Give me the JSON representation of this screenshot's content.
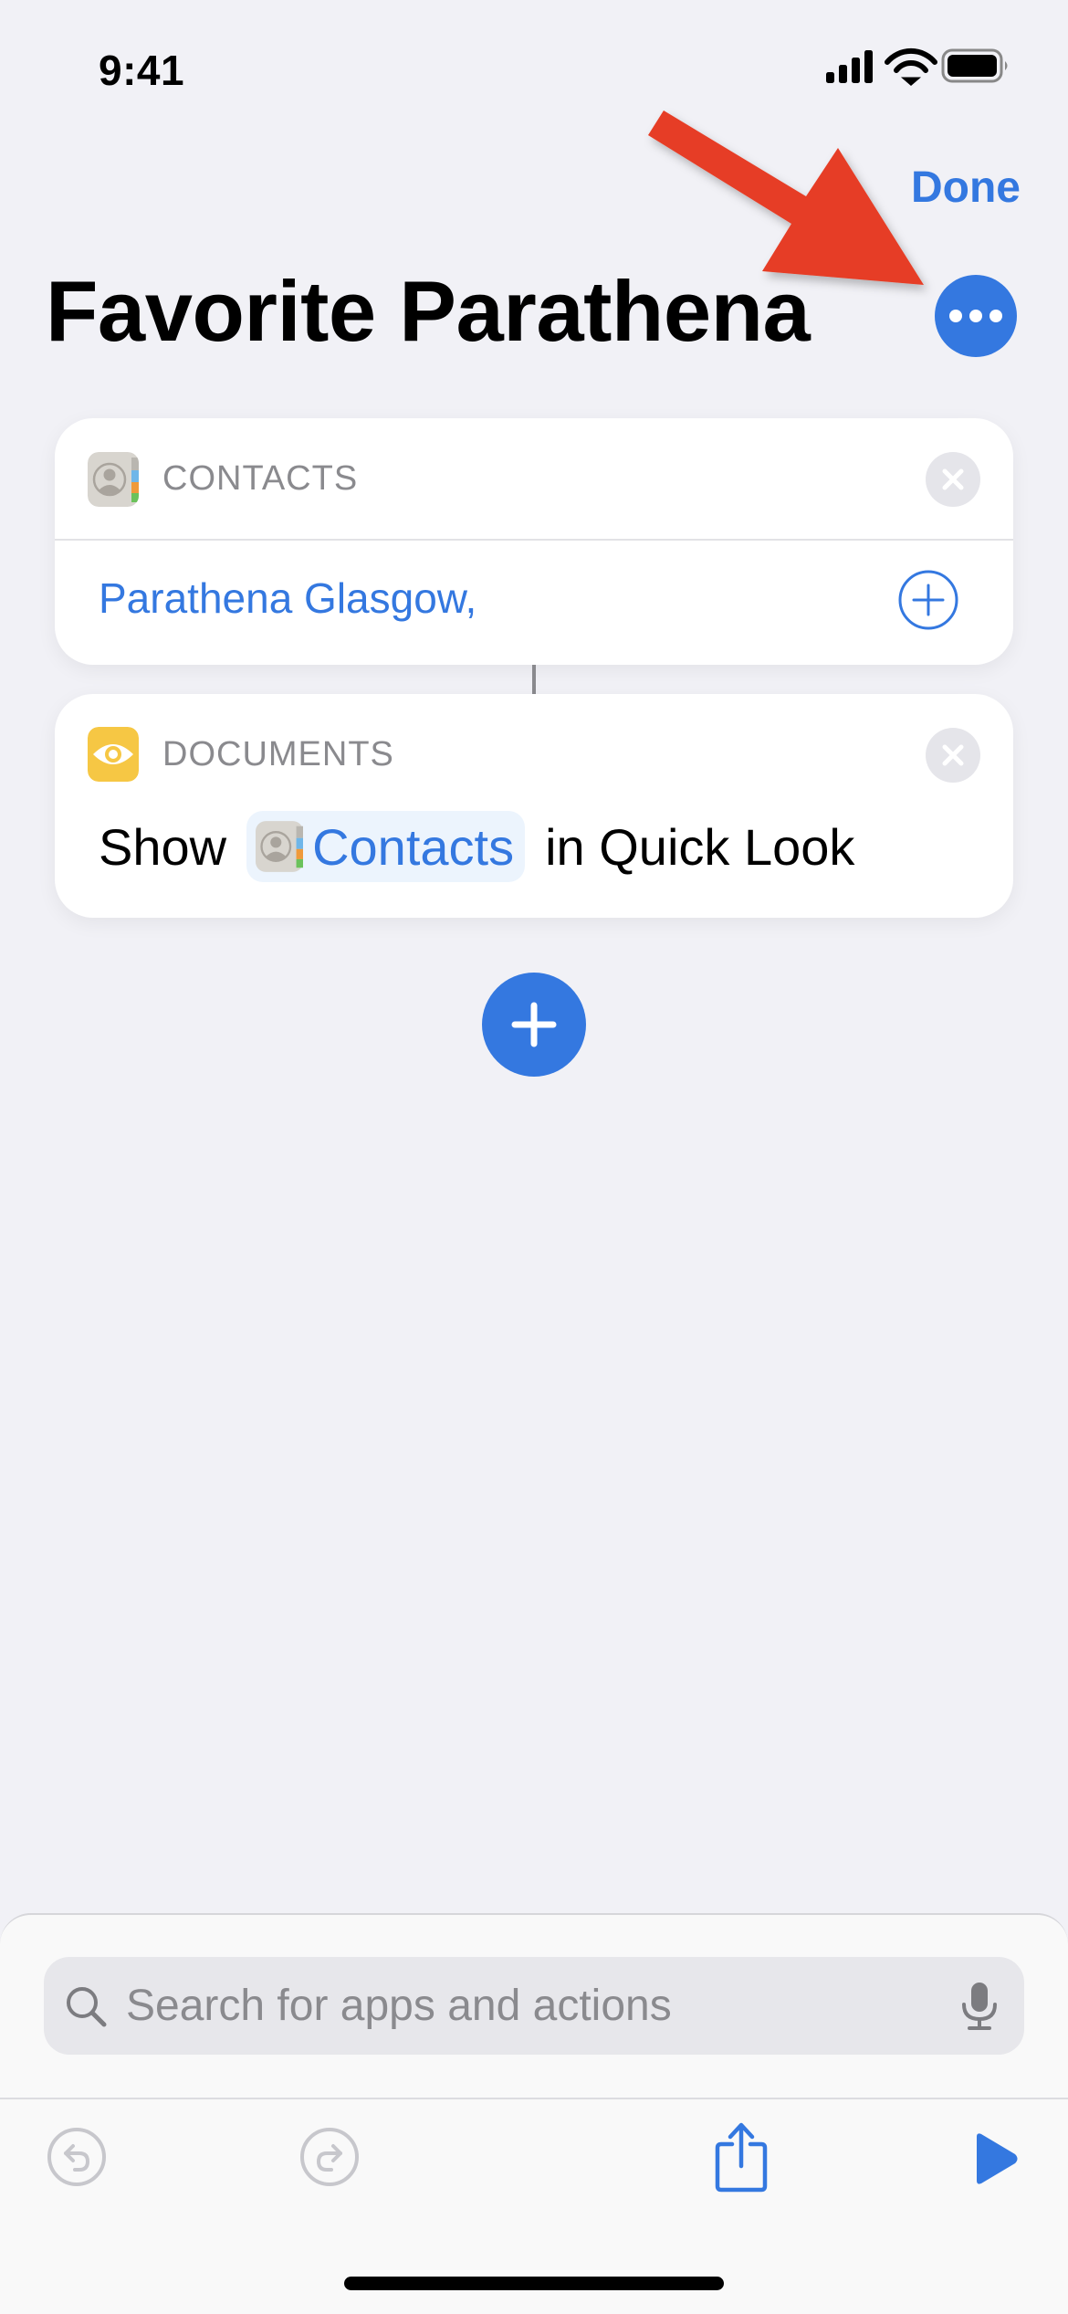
{
  "status_bar": {
    "time": "9:41",
    "icons": [
      "cellular-signal-icon",
      "wifi-icon",
      "battery-icon"
    ]
  },
  "nav": {
    "done_label": "Done",
    "title": "Favorite Parathena",
    "more_icon": "ellipsis-circle-icon"
  },
  "annotation": {
    "type": "arrow",
    "color": "#e63e25",
    "points_to": "more-options-button"
  },
  "actions": [
    {
      "category": "CONTACTS",
      "icon": "contacts-app-icon",
      "value": "Parathena Glasgow,",
      "add_icon": "plus-circle-icon"
    },
    {
      "category": "DOCUMENTS",
      "icon": "quick-look-eye-icon",
      "text_before": "Show",
      "variable": {
        "label": "Contacts",
        "icon": "contacts-app-icon"
      },
      "text_after": "in Quick Look"
    }
  ],
  "add_action_icon": "plus-icon",
  "search": {
    "placeholder": "Search for apps and actions",
    "search_icon": "magnifying-glass-icon",
    "mic_icon": "microphone-icon"
  },
  "toolbar": {
    "items": [
      {
        "name": "undo",
        "icon": "undo-icon",
        "enabled": false
      },
      {
        "name": "redo",
        "icon": "redo-icon",
        "enabled": false
      },
      {
        "name": "share",
        "icon": "share-icon",
        "enabled": true
      },
      {
        "name": "run",
        "icon": "play-icon",
        "enabled": true
      }
    ]
  },
  "colors": {
    "accent": "#3478e0",
    "background": "#f1f1f6",
    "card": "#ffffff",
    "secondary_text": "#8a8a8e",
    "annotation_arrow": "#e63e25",
    "documents_icon": "#f6c744",
    "disabled_icon": "#c7c7cc"
  }
}
